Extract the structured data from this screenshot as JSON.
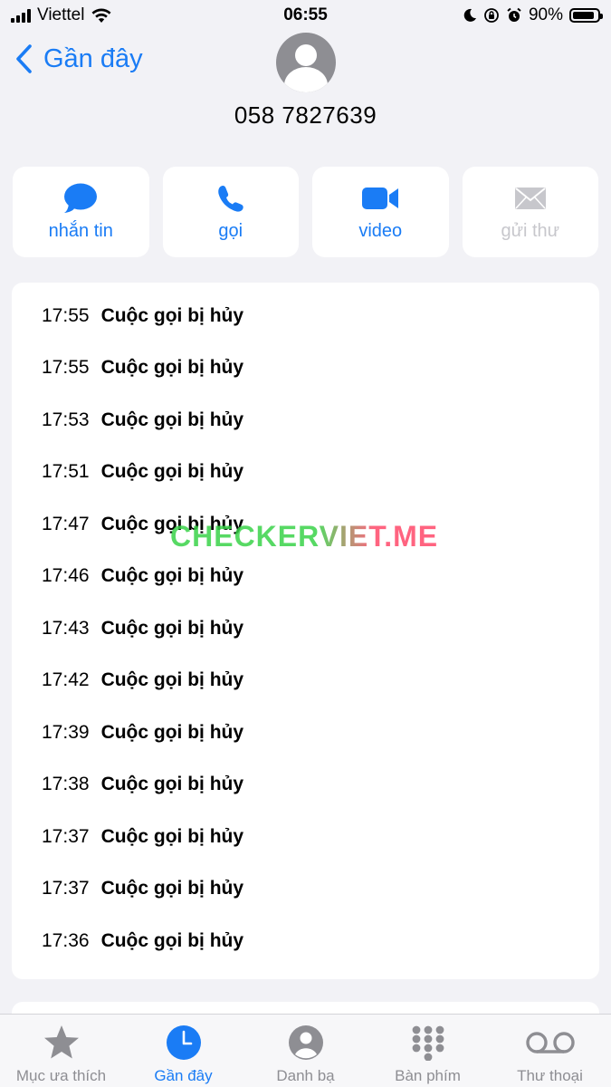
{
  "status_bar": {
    "carrier": "Viettel",
    "time": "06:55",
    "battery": "90%"
  },
  "nav": {
    "back_label": "Gần đây"
  },
  "contact": {
    "number": "058 7827639"
  },
  "actions": [
    {
      "label": "nhắn tin",
      "icon": "message-icon",
      "enabled": true
    },
    {
      "label": "gọi",
      "icon": "phone-icon",
      "enabled": true
    },
    {
      "label": "video",
      "icon": "video-icon",
      "enabled": true
    },
    {
      "label": "gửi thư",
      "icon": "mail-icon",
      "enabled": false
    }
  ],
  "calls": [
    {
      "time": "17:55",
      "status": "Cuộc gọi bị hủy"
    },
    {
      "time": "17:55",
      "status": "Cuộc gọi bị hủy"
    },
    {
      "time": "17:53",
      "status": "Cuộc gọi bị hủy"
    },
    {
      "time": "17:51",
      "status": "Cuộc gọi bị hủy"
    },
    {
      "time": "17:47",
      "status": "Cuộc gọi bị hủy"
    },
    {
      "time": "17:46",
      "status": "Cuộc gọi bị hủy"
    },
    {
      "time": "17:43",
      "status": "Cuộc gọi bị hủy"
    },
    {
      "time": "17:42",
      "status": "Cuộc gọi bị hủy"
    },
    {
      "time": "17:39",
      "status": "Cuộc gọi bị hủy"
    },
    {
      "time": "17:38",
      "status": "Cuộc gọi bị hủy"
    },
    {
      "time": "17:37",
      "status": "Cuộc gọi bị hủy"
    },
    {
      "time": "17:37",
      "status": "Cuộc gọi bị hủy"
    },
    {
      "time": "17:36",
      "status": "Cuộc gọi bị hủy"
    }
  ],
  "watermark": "CHECKERVIET.ME",
  "tabs": [
    {
      "label": "Mục ưa thích",
      "icon": "star-icon",
      "active": false
    },
    {
      "label": "Gần đây",
      "icon": "clock-icon",
      "active": true
    },
    {
      "label": "Danh bạ",
      "icon": "contacts-icon",
      "active": false
    },
    {
      "label": "Bàn phím",
      "icon": "keypad-icon",
      "active": false
    },
    {
      "label": "Thư thoại",
      "icon": "voicemail-icon",
      "active": false
    }
  ],
  "colors": {
    "accent": "#1a7cf5",
    "background": "#f2f2f6",
    "inactive": "#8e8e93",
    "disabled": "#c7c7cc"
  }
}
